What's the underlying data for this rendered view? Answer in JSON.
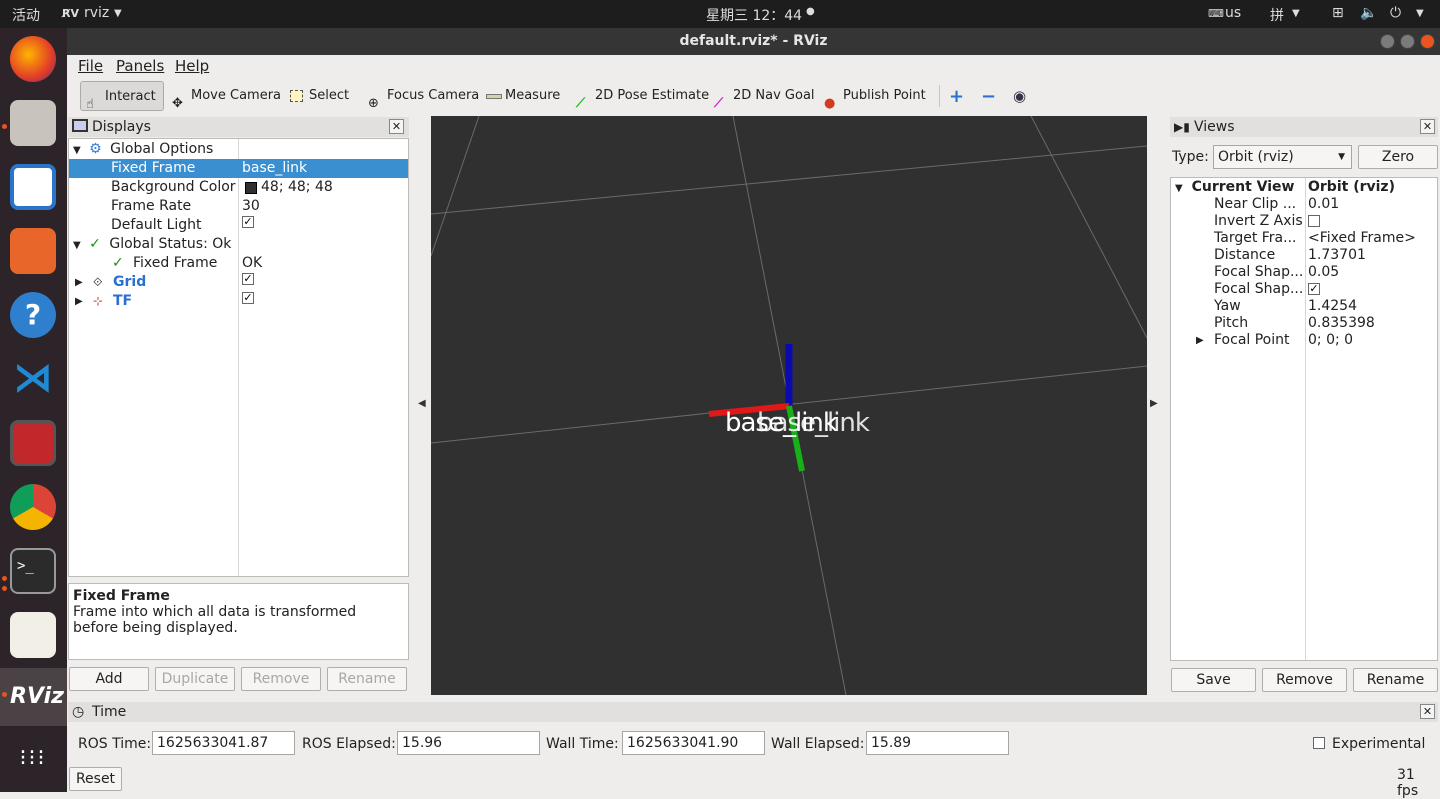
{
  "system_bar": {
    "activities": "活动",
    "app_name": "rviz",
    "clock": "星期三 12：44",
    "keyboard": "us",
    "input_method": "拼"
  },
  "window": {
    "title": "default.rviz* - RViz"
  },
  "menu": [
    "File",
    "Panels",
    "Help"
  ],
  "toolbar": {
    "interact": "Interact",
    "move_camera": "Move Camera",
    "select": "Select",
    "focus_camera": "Focus Camera",
    "measure": "Measure",
    "pose_estimate": "2D Pose Estimate",
    "nav_goal": "2D Nav Goal",
    "publish_point": "Publish Point"
  },
  "displays": {
    "title": "Displays",
    "global_options": "Global Options",
    "fixed_frame_label": "Fixed Frame",
    "fixed_frame_value": "base_link",
    "bg_color_label": "Background Color",
    "bg_color_value": "48; 48; 48",
    "frame_rate_label": "Frame Rate",
    "frame_rate_value": "30",
    "default_light_label": "Default Light",
    "global_status": "Global Status: Ok",
    "status_fixed_frame": "Fixed Frame",
    "status_fixed_frame_value": "OK",
    "grid": "Grid",
    "tf": "TF",
    "desc_title": "Fixed Frame",
    "desc_text": "Frame into which all data is transformed before being displayed.",
    "buttons": {
      "add": "Add",
      "duplicate": "Duplicate",
      "remove": "Remove",
      "rename": "Rename"
    }
  },
  "viewport": {
    "frame_label": "base_link",
    "overlap_label": "base_link",
    "bg_color": "#303030"
  },
  "views": {
    "title": "Views",
    "type_label": "Type:",
    "type_value": "Orbit (rviz)",
    "zero": "Zero",
    "current_view": "Current View",
    "current_view_value": "Orbit (rviz)",
    "props": [
      {
        "name": "Near Clip ...",
        "value": "0.01"
      },
      {
        "name": "Invert Z Axis",
        "value": ""
      },
      {
        "name": "Target Fra...",
        "value": "<Fixed Frame>"
      },
      {
        "name": "Distance",
        "value": "1.73701"
      },
      {
        "name": "Focal Shap...",
        "value": "0.05"
      },
      {
        "name": "Focal Shap...",
        "value": ""
      },
      {
        "name": "Yaw",
        "value": "1.4254"
      },
      {
        "name": "Pitch",
        "value": "0.835398"
      },
      {
        "name": "Focal Point",
        "value": "0; 0; 0"
      }
    ],
    "buttons": {
      "save": "Save",
      "remove": "Remove",
      "rename": "Rename"
    }
  },
  "time": {
    "title": "Time",
    "ros_time_label": "ROS Time:",
    "ros_time": "1625633041.87",
    "ros_elapsed_label": "ROS Elapsed:",
    "ros_elapsed": "15.96",
    "wall_time_label": "Wall Time:",
    "wall_time": "1625633041.90",
    "wall_elapsed_label": "Wall Elapsed:",
    "wall_elapsed": "15.89",
    "experimental": "Experimental",
    "reset": "Reset",
    "fps": "31 fps"
  }
}
